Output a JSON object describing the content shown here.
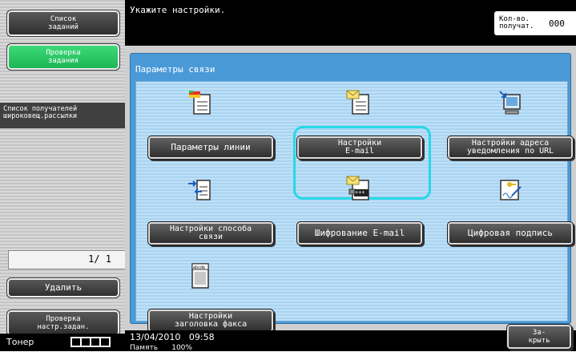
{
  "sidebar": {
    "job_list_label": "Список\nзаданий",
    "job_check_label": "Проверка\nзадания",
    "broadcast_list_label": "Список получателей\nшироковещ.рассылки",
    "page_indicator": "1/  1",
    "delete_label": "Удалить",
    "check_settings_label": "Проверка\nнастр.задан.",
    "toner_label": "Тонер"
  },
  "header": {
    "prompt": "Укажите настройки.",
    "copies_label": "Кол-во.\nполучат.",
    "copies_value": "000"
  },
  "panel": {
    "title": "Параметры связи",
    "options": [
      {
        "label": "Параметры линии",
        "icon": "line-parameters-icon"
      },
      {
        "label": "Настройки\nE-mail",
        "icon": "email-settings-icon",
        "selected": true
      },
      {
        "label": "Настройки адреса\nуведомления по URL",
        "icon": "url-notification-icon"
      },
      {
        "label": "Настройки способа\nсвязи",
        "icon": "connection-method-icon"
      },
      {
        "label": "Шифрование E-mail",
        "icon": "email-encryption-icon"
      },
      {
        "label": "Цифровая подпись",
        "icon": "digital-signature-icon"
      },
      {
        "label": "Настройки\nзаголовка факса",
        "icon": "fax-header-icon"
      }
    ]
  },
  "footer": {
    "date": "13/04/2010",
    "time": "09:58",
    "memory_label": "Память",
    "memory_value": "100%",
    "close_label": "За-\nкрыть"
  },
  "colors": {
    "panel_blue": "#4a9ad8",
    "selection_ring": "#27d8e6",
    "active_green": "#1bb354"
  }
}
